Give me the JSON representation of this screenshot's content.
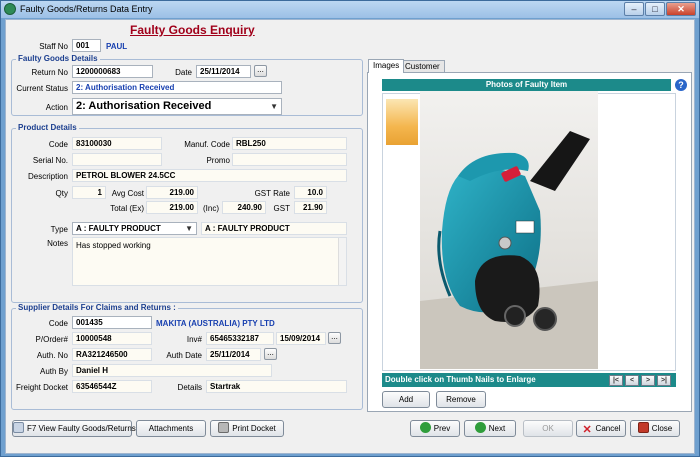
{
  "window": {
    "title": "Faulty Goods/Returns Data Entry",
    "minimize": "–",
    "maximize": "□",
    "close": "✕"
  },
  "form": {
    "heading": "Faulty Goods Enquiry",
    "staff": {
      "label": "Staff No",
      "value": "001",
      "name": "PAUL"
    }
  },
  "faulty_goods": {
    "group_title": "Faulty Goods Details",
    "return_no_label": "Return No",
    "return_no": "1200000683",
    "date_label": "Date",
    "date": "25/11/2014",
    "current_status_label": "Current Status",
    "current_status": "2: Authorisation Received",
    "action_label": "Action",
    "action": "2: Authorisation Received"
  },
  "product": {
    "group_title": "Product Details",
    "code_label": "Code",
    "code": "83100030",
    "manuf_code_label": "Manuf. Code",
    "manuf_code": "RBL250",
    "serial_label": "Serial No.",
    "serial": "",
    "promo_label": "Promo",
    "promo": "",
    "description_label": "Description",
    "description": "PETROL BLOWER 24.5CC",
    "qty_label": "Qty",
    "qty": "1",
    "avg_cost_label": "Avg Cost",
    "avg_cost": "219.00",
    "gst_rate_label": "GST Rate",
    "gst_rate": "10.0",
    "total_ex_label": "Total (Ex)",
    "total_ex": "219.00",
    "inc_label": "(Inc)",
    "total_inc": "240.90",
    "gst_label": "GST",
    "gst": "21.90",
    "type_label": "Type",
    "type_select": "A : FAULTY PRODUCT",
    "type_desc": "A : FAULTY PRODUCT",
    "notes_label": "Notes",
    "notes": "Has stopped working"
  },
  "supplier": {
    "group_title": "Supplier Details For Claims and Returns :",
    "code_label": "Code",
    "code": "001435",
    "name": "MAKITA (AUSTRALIA) PTY LTD",
    "porder_label": "P/Order#",
    "porder": "10000548",
    "inv_label": "Inv#",
    "inv": "65465332187",
    "inv_date": "15/09/2014",
    "auth_no_label": "Auth. No",
    "auth_no": "RA321246500",
    "auth_date_label": "Auth Date",
    "auth_date": "25/11/2014",
    "auth_by_label": "Auth By",
    "auth_by": "Daniel H",
    "freight_label": "Freight Docket",
    "freight": "63546544Z",
    "details_label": "Details",
    "details": "Startrak"
  },
  "images_panel": {
    "tabs": [
      "Images",
      "Customer"
    ],
    "photos_title": "Photos of Faulty Item",
    "help": "?",
    "hint": "Double click on Thumb Nails to Enlarge",
    "nav": [
      "|<",
      "<",
      ">",
      ">|"
    ],
    "add_label": "Add",
    "remove_label": "Remove"
  },
  "buttons": {
    "view_faulty": "F7 View Faulty Goods/Returns",
    "attachments": "Attachments",
    "print_docket": "Print Docket",
    "prev": "Prev",
    "next": "Next",
    "ok": "OK",
    "cancel": "Cancel",
    "close": "Close"
  },
  "ellipsis": "..."
}
